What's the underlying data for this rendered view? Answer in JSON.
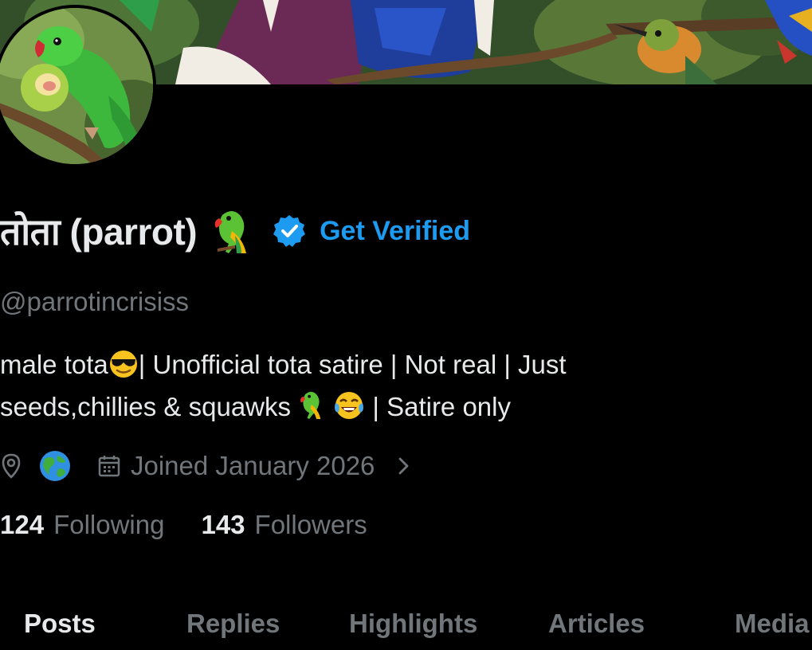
{
  "profile": {
    "display_name": "तोता (parrot)",
    "name_emoji": "parrot-emoji",
    "verified_badge": "verified-badge-icon",
    "get_verified_label": "Get Verified",
    "handle": "@parrotincrisiss",
    "bio_line1_a": "male tota",
    "bio_line1_b": "|  Unofficial tota satire | Not real | Just",
    "bio_line2_a": "seeds,chillies & squawks ",
    "bio_line2_b": " | Satire only",
    "location_icon": "location-pin-icon",
    "location_value_icon": "globe-emoji",
    "calendar_icon": "calendar-icon",
    "joined": "Joined January 2026",
    "following_count": "124",
    "following_label": "Following",
    "followers_count": "143",
    "followers_label": "Followers"
  },
  "tabs": [
    {
      "label": "Posts",
      "active": true
    },
    {
      "label": "Replies",
      "active": false
    },
    {
      "label": "Highlights",
      "active": false
    },
    {
      "label": "Articles",
      "active": false
    },
    {
      "label": "Media",
      "active": false
    }
  ],
  "colors": {
    "background": "#000000",
    "primary_text": "#e7e9ea",
    "secondary_text": "#71767b",
    "accent": "#1d9bf0"
  }
}
